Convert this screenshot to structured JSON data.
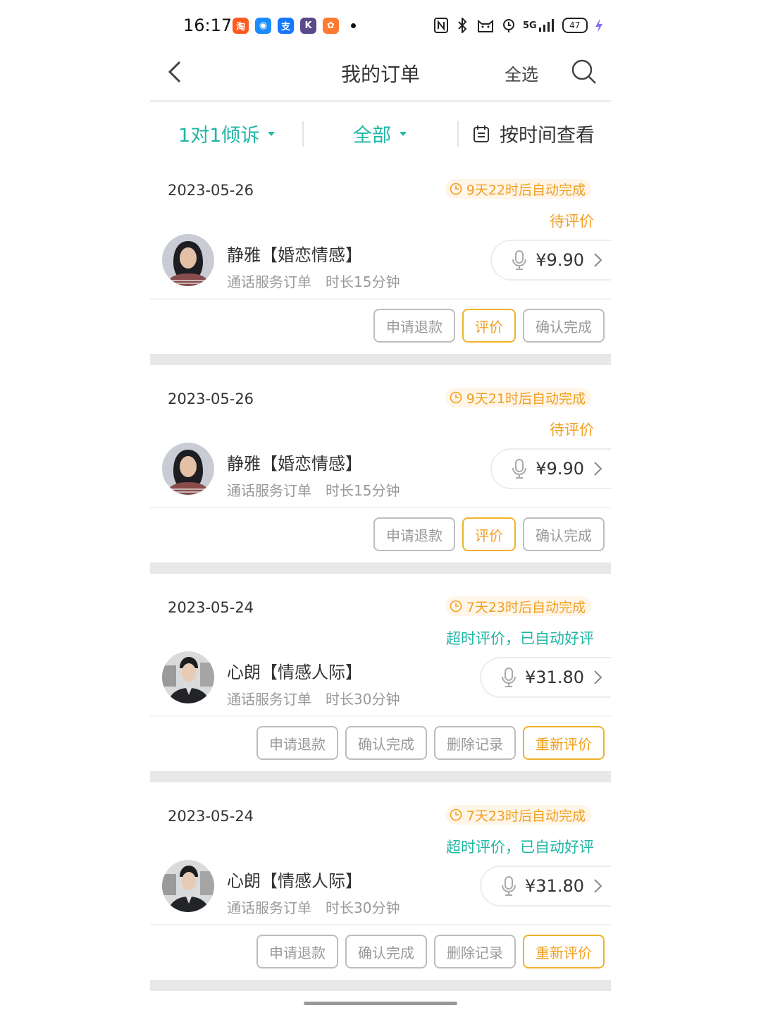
{
  "status_bar": {
    "time": "16:17",
    "app_icons": [
      {
        "name": "taobao-icon",
        "glyph": "淘",
        "color": "#ff5a1f"
      },
      {
        "name": "qq-icon",
        "glyph": "◉",
        "color": "#1a8cff"
      },
      {
        "name": "alipay-icon",
        "glyph": "支",
        "color": "#1677ff"
      },
      {
        "name": "k-app-icon",
        "glyph": "K",
        "color": "#5b4a8a"
      },
      {
        "name": "orange-app-icon",
        "glyph": "✿",
        "color": "#ff7a2f"
      }
    ],
    "network_label": "5G",
    "battery": "47"
  },
  "header": {
    "title": "我的订单",
    "select_all": "全选"
  },
  "filters": {
    "category": "1对1倾诉",
    "status": "全部",
    "time_view": "按时间查看"
  },
  "orders": [
    {
      "date": "2023-05-26",
      "countdown": "9天22时后自动完成",
      "status": "待评价",
      "consultant": "静雅【婚恋情感】",
      "service_type": "通话服务订单",
      "duration": "时长15分钟",
      "price": "¥9.90",
      "buttons": [
        "申请退款",
        "评价",
        "确认完成"
      ]
    },
    {
      "date": "2023-05-26",
      "countdown": "9天21时后自动完成",
      "status": "待评价",
      "consultant": "静雅【婚恋情感】",
      "service_type": "通话服务订单",
      "duration": "时长15分钟",
      "price": "¥9.90",
      "buttons": [
        "申请退款",
        "评价",
        "确认完成"
      ]
    },
    {
      "date": "2023-05-24",
      "countdown": "7天23时后自动完成",
      "status": "超时评价，已自动好评",
      "consultant": "心朗【情感人际】",
      "service_type": "通话服务订单",
      "duration": "时长30分钟",
      "price": "¥31.80",
      "buttons": [
        "申请退款",
        "确认完成",
        "删除记录",
        "重新评价"
      ]
    },
    {
      "date": "2023-05-24",
      "countdown": "7天23时后自动完成",
      "status": "超时评价，已自动好评",
      "consultant": "心朗【情感人际】",
      "service_type": "通话服务订单",
      "duration": "时长30分钟",
      "price": "¥31.80",
      "buttons": [
        "申请退款",
        "确认完成",
        "删除记录",
        "重新评价"
      ]
    }
  ],
  "colors": {
    "accent_teal": "#1fb6a5",
    "accent_orange": "#f0a020"
  }
}
